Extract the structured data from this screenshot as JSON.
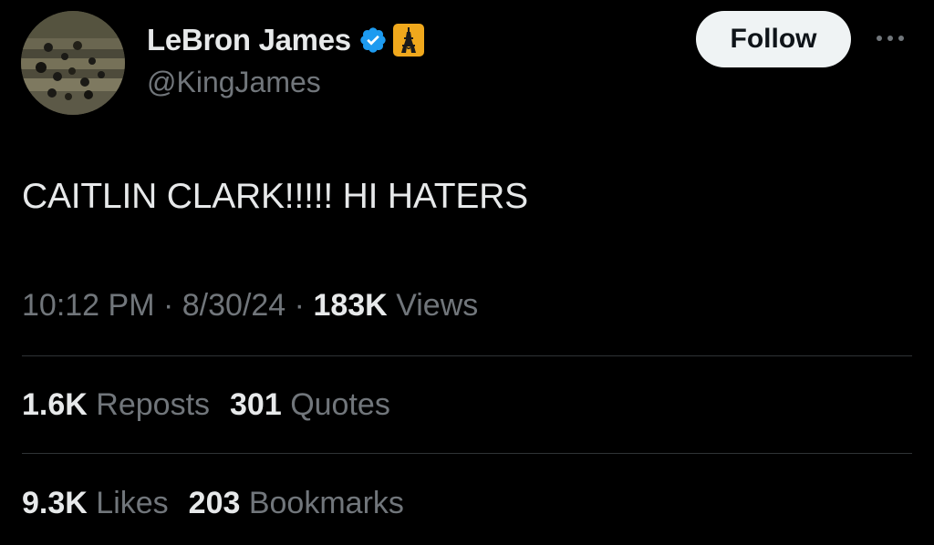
{
  "author": {
    "display_name": "LeBron James",
    "handle": "@KingJames",
    "verified_badge_icon": "verified-check-icon",
    "affiliate_badge_icon": "eiffel-tower-icon"
  },
  "actions": {
    "follow_label": "Follow",
    "more_icon": "more-horizontal-icon"
  },
  "tweet": {
    "text": "CAITLIN CLARK!!!!! HI HATERS",
    "time": "10:12 PM",
    "separator": "·",
    "date": "8/30/24",
    "views_count": "183K",
    "views_label": "Views"
  },
  "stats": {
    "reposts_count": "1.6K",
    "reposts_label": "Reposts",
    "quotes_count": "301",
    "quotes_label": "Quotes",
    "likes_count": "9.3K",
    "likes_label": "Likes",
    "bookmarks_count": "203",
    "bookmarks_label": "Bookmarks"
  },
  "colors": {
    "background": "#000000",
    "primary_text": "#e7e9ea",
    "secondary_text": "#71767b",
    "verified_blue": "#1d9bf0",
    "affiliate_gold": "#f0a81c",
    "follow_button_bg": "#eff3f4",
    "divider": "#2f3336"
  }
}
